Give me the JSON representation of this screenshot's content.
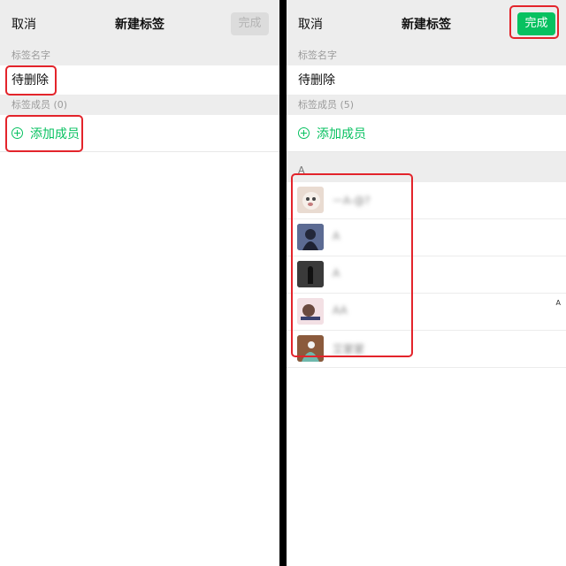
{
  "left": {
    "nav": {
      "cancel": "取消",
      "title": "新建标签",
      "done": "完成"
    },
    "tag_name_header": "标签名字",
    "tag_name": "待删除",
    "members_header": "标签成员 (0)",
    "add_member": "添加成员"
  },
  "right": {
    "nav": {
      "cancel": "取消",
      "title": "新建标签",
      "done": "完成"
    },
    "tag_name_header": "标签名字",
    "tag_name": "待删除",
    "members_header": "标签成员 (5)",
    "add_member": "添加成员",
    "group_letter": "A",
    "index_letter": "A",
    "contacts": [
      {
        "name": "ーA-@?",
        "avatar_color": "#e9dbd1"
      },
      {
        "name": "A",
        "avatar_color": "#3f4a6b"
      },
      {
        "name": "A",
        "avatar_color": "#2a2a2a"
      },
      {
        "name": "AA",
        "avatar_color": "#f1d9de"
      },
      {
        "name": "艾蒙蒙",
        "avatar_color": "#6fa8a2"
      }
    ]
  },
  "colors": {
    "accent": "#07c160",
    "highlight": "#e3242b",
    "nav_bg": "#ededed"
  }
}
